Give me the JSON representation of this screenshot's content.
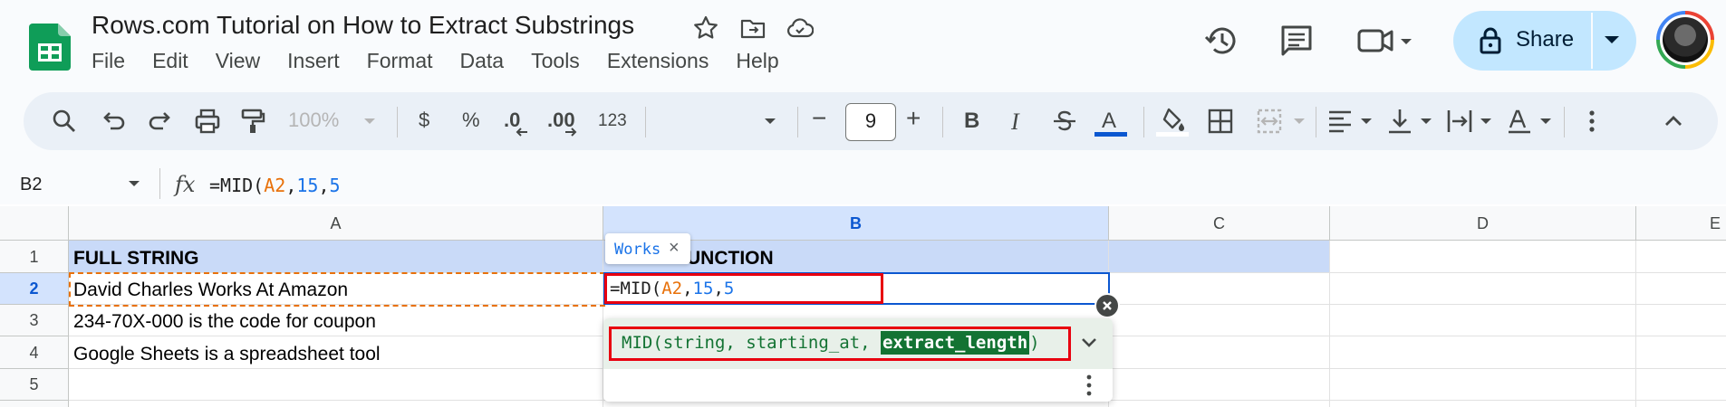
{
  "app": {
    "title": "Rows.com Tutorial on How to Extract Substrings",
    "menus": [
      "File",
      "Edit",
      "View",
      "Insert",
      "Format",
      "Data",
      "Tools",
      "Extensions",
      "Help"
    ],
    "share_label": "Share",
    "title_icons": [
      "star-icon",
      "move-to-folder-icon",
      "cloud-saved-icon"
    ],
    "header_icons": [
      "version-history-icon",
      "comments-icon",
      "meet-icon"
    ]
  },
  "toolbar": {
    "zoom": "100%",
    "currency": "$",
    "percent": "%",
    "decrease_decimal": ".0",
    "increase_decimal": ".00",
    "number_format": "123",
    "font_size": "9",
    "minus": "−",
    "plus": "+",
    "bold": "B",
    "italic": "I",
    "text_color": "A"
  },
  "formula_bar": {
    "name_box": "B2",
    "fx": "fx",
    "formula": {
      "prefix": "=MID(",
      "ref": "A2",
      "sep1": ",",
      "arg2": "15",
      "sep2": ",",
      "arg3": "5"
    }
  },
  "sheet": {
    "columns": [
      "A",
      "B",
      "C",
      "D",
      "E"
    ],
    "rows": [
      "1",
      "2",
      "3",
      "4",
      "5"
    ],
    "cells": {
      "A1": "FULL STRING",
      "B1": "UNCTION",
      "A2": "David Charles Works At Amazon",
      "A3": "234-70X-000 is the code for coupon",
      "A4": "Google Sheets is a spreadsheet tool"
    },
    "active_cell": {
      "prefix": "=MID(",
      "ref": "A2",
      "sep1": ",",
      "arg2": "15",
      "sep2": ",",
      "arg3": "5"
    },
    "tooltip_chip": "Works",
    "tooltip_close": "×"
  },
  "function_help": {
    "prefix": "MID(string, starting_at, ",
    "highlighted_param": "extract_length",
    "suffix": ")"
  },
  "colors": {
    "accent": "#0b57d0",
    "header_band": "#c9daf8",
    "selected_header": "#d3e3fd",
    "share_bg": "#c2e7ff",
    "highlight_param": "#137333",
    "annotation_red": "#e8000f",
    "ref_orange": "#e8710a"
  }
}
